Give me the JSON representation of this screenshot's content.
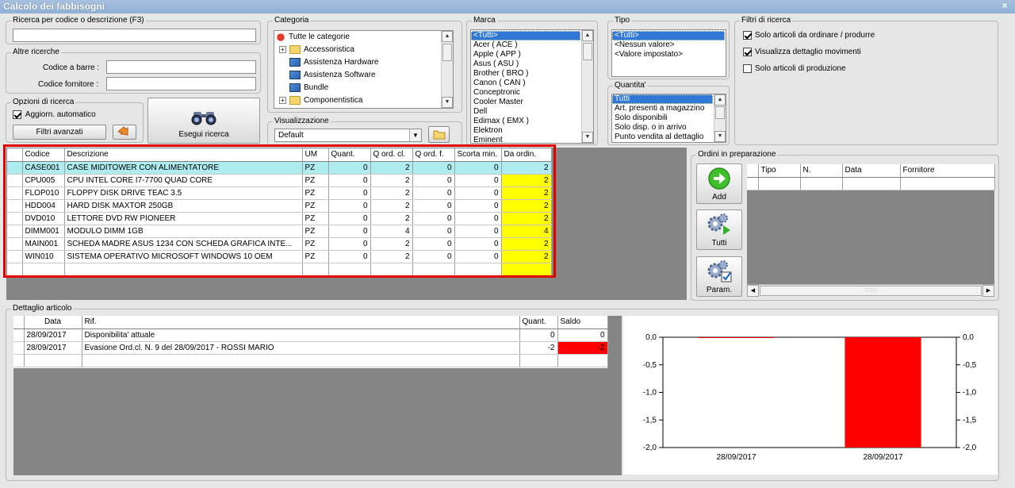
{
  "window": {
    "title": "Calcolo dei fabbisogni",
    "close": "×"
  },
  "search": {
    "label": "Ricerca per codice o descrizione (F3)",
    "value": ""
  },
  "altre": {
    "label": "Altre ricerche",
    "barcode_label": "Codice a barre :",
    "barcode_value": "",
    "supplier_label": "Codice fornitore :",
    "supplier_value": ""
  },
  "opzioni": {
    "label": "Opzioni di ricerca",
    "auto_label": "Aggiorn. automatico",
    "auto_checked": true,
    "advanced_label": "Filtri avanzati"
  },
  "run_search_label": "Esegui ricerca",
  "categoria": {
    "label": "Categoria",
    "items": [
      "Tutte le categorie",
      "Accessoristica",
      "Assistenza Hardware",
      "Assistenza Software",
      "Bundle",
      "Componentistica"
    ]
  },
  "visualizzazione": {
    "label": "Visualizzazione",
    "value": "Default"
  },
  "marca": {
    "label": "Marca",
    "items": [
      "<Tutti>",
      "Acer ( ACE )",
      "Apple ( APP )",
      "Asus ( ASU )",
      "Brother ( BRO )",
      "Canon ( CAN )",
      "Conceptronic",
      "Cooler Master",
      "Dell",
      "Edimax ( EMX )",
      "Elektron",
      "Eminent"
    ]
  },
  "tipo": {
    "label": "Tipo",
    "items": [
      "<Tutti>",
      "<Nessun valore>",
      "<Valore impostato>"
    ]
  },
  "quantita": {
    "label": "Quantita'",
    "items": [
      "Tutti",
      "Art. presenti a magazzino",
      "Solo disponibili",
      "Solo disp. o in arrivo",
      "Punto vendita al dettaglio"
    ]
  },
  "filtri": {
    "label": "Filtri di ricerca",
    "items": [
      {
        "label": "Solo articoli da ordinare / produrre",
        "checked": true
      },
      {
        "label": "Visualizza dettaglio movimenti",
        "checked": true
      },
      {
        "label": "Solo articoli di produzione",
        "checked": false
      }
    ]
  },
  "articles": {
    "headers": [
      "Codice",
      "Descrizione",
      "UM",
      "Quant.",
      "Q ord. cl.",
      "Q ord. f.",
      "Scorta min.",
      "Da ordin."
    ],
    "rows": [
      [
        "CASE001",
        "CASE MIDITOWER CON ALIMENTATORE",
        "PZ",
        "0",
        "2",
        "0",
        "0",
        "2"
      ],
      [
        "CPU005",
        "CPU INTEL CORE I7-7700 QUAD CORE",
        "PZ",
        "0",
        "2",
        "0",
        "0",
        "2"
      ],
      [
        "FLOP010",
        "FLOPPY DISK DRIVE TEAC 3.5",
        "PZ",
        "0",
        "2",
        "0",
        "0",
        "2"
      ],
      [
        "HDD004",
        "HARD DISK MAXTOR 250GB",
        "PZ",
        "0",
        "2",
        "0",
        "0",
        "2"
      ],
      [
        "DVD010",
        "LETTORE DVD RW PIONEER",
        "PZ",
        "0",
        "2",
        "0",
        "0",
        "2"
      ],
      [
        "DIMM001",
        "MODULO DIMM 1GB",
        "PZ",
        "0",
        "4",
        "0",
        "0",
        "4"
      ],
      [
        "MAIN001",
        "SCHEDA MADRE ASUS 1234 CON SCHEDA GRAFICA INTE...",
        "PZ",
        "0",
        "2",
        "0",
        "0",
        "2"
      ],
      [
        "WIN010",
        "SISTEMA OPERATIVO MICROSOFT WINDOWS 10 OEM",
        "PZ",
        "0",
        "2",
        "0",
        "0",
        "2"
      ]
    ]
  },
  "ordini": {
    "label": "Ordini in preparazione",
    "headers": [
      "Tipo",
      "N.",
      "Data",
      "Fornitore"
    ],
    "add_label": "Add",
    "tutti_label": "Tutti",
    "param_label": "Param."
  },
  "dettaglio": {
    "label": "Dettaglio articolo",
    "headers": [
      "Data",
      "Rif.",
      "Quant.",
      "Saldo"
    ],
    "rows": [
      [
        "28/09/2017",
        "Disponibilita' attuale",
        "0",
        "0"
      ],
      [
        "28/09/2017",
        "Evasione Ord.cl. N. 9 del 28/09/2017 - ROSSI MARIO",
        "-2",
        "-2"
      ]
    ]
  },
  "chart_data": {
    "type": "bar",
    "categories": [
      "28/09/2017",
      "28/09/2017"
    ],
    "values": [
      0,
      -2
    ],
    "ylim": [
      -2.0,
      0.0
    ],
    "yticks": [
      "0,0",
      "-0,5",
      "-1,0",
      "-1,5",
      "-2,0"
    ],
    "bar_color": "#ff0000",
    "grid": false,
    "title": "",
    "xlabel": "",
    "ylabel": ""
  },
  "colors": {
    "highlight_row": "#aeecef",
    "to_order": "#ffff00",
    "negative": "#ff0000",
    "selection_border": "#e00000"
  }
}
